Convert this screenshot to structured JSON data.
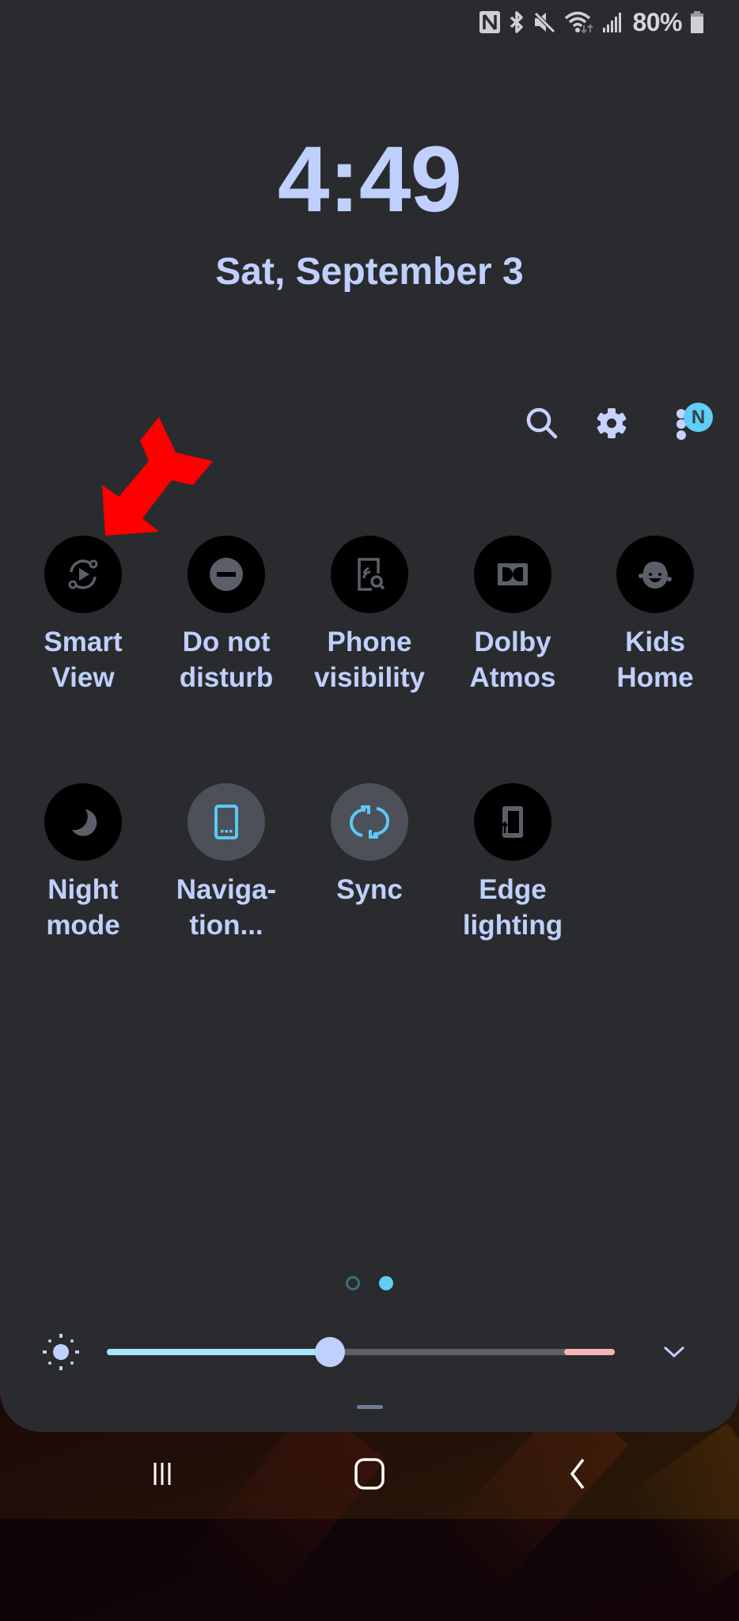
{
  "status_bar": {
    "icons": [
      "nfc-icon",
      "bluetooth-icon",
      "mute-icon",
      "wifi-icon",
      "signal-icon",
      "battery-icon"
    ],
    "battery_percent": "80%"
  },
  "lockscreen": {
    "time": "4:49",
    "date": "Sat, September 3"
  },
  "header_actions": {
    "search": "search-icon",
    "settings": "gear-icon",
    "more": "more-options-icon",
    "badge_letter": "N"
  },
  "annotation": {
    "type": "red-arrow",
    "points_to": "Smart View",
    "color": "#ff0000"
  },
  "quick_settings": {
    "tiles": [
      {
        "label_line1": "Smart",
        "label_line2": "View",
        "icon": "smart-view-icon",
        "active": false
      },
      {
        "label_line1": "Do not",
        "label_line2": "disturb",
        "icon": "do-not-disturb-icon",
        "active": false
      },
      {
        "label_line1": "Phone",
        "label_line2": "visibility",
        "icon": "phone-visibility-icon",
        "active": false
      },
      {
        "label_line1": "Dolby",
        "label_line2": "Atmos",
        "icon": "dolby-atmos-icon",
        "active": false
      },
      {
        "label_line1": "Kids",
        "label_line2": "Home",
        "icon": "kids-home-icon",
        "active": false
      },
      {
        "label_line1": "Night",
        "label_line2": "mode",
        "icon": "night-mode-icon",
        "active": false
      },
      {
        "label_line1": "Naviga-",
        "label_line2": "tion...",
        "icon": "navigation-bar-icon",
        "active": true
      },
      {
        "label_line1": "Sync",
        "label_line2": "",
        "icon": "sync-icon",
        "active": true
      },
      {
        "label_line1": "Edge",
        "label_line2": "lighting",
        "icon": "edge-lighting-icon",
        "active": false
      }
    ]
  },
  "pager": {
    "total_pages": 2,
    "current_page": 2
  },
  "brightness": {
    "value": 0.44,
    "warning_zone_start": 0.9
  },
  "colors": {
    "panel_bg": "#2a2b2e",
    "text_accent": "#bfd0ff",
    "active_icon": "#5cc8f5",
    "inactive_icon": "#5a6069",
    "active_tile_bg": "#4b5059",
    "badge": "#5fcff5"
  },
  "nav_bar": {
    "recents": "recents-icon",
    "home": "home-icon",
    "back": "back-icon"
  }
}
